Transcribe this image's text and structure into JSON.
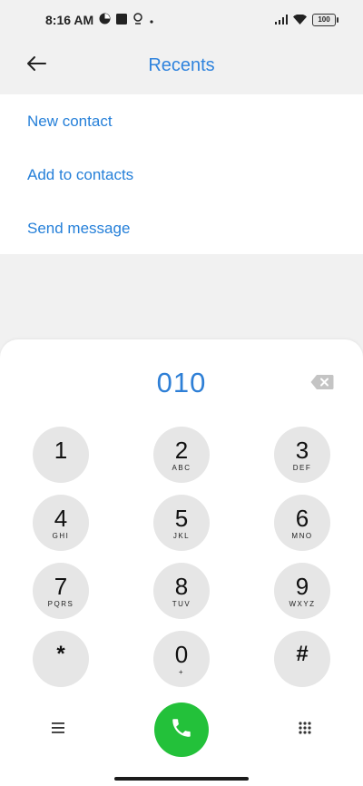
{
  "status_bar": {
    "time": "8:16 AM",
    "battery": "100",
    "icons": [
      "circle-notification-icon",
      "square-app-icon",
      "lock-notification-icon",
      "dot-icon",
      "signal-icon",
      "wifi-icon",
      "battery-icon"
    ]
  },
  "header": {
    "title": "Recents",
    "back_icon": "arrow-left-icon"
  },
  "actions": [
    {
      "label": "New contact"
    },
    {
      "label": "Add to contacts"
    },
    {
      "label": "Send message"
    }
  ],
  "dialer": {
    "number": "010",
    "backspace_icon": "backspace-icon",
    "keys": [
      {
        "digit": "1",
        "letters": ""
      },
      {
        "digit": "2",
        "letters": "ABC"
      },
      {
        "digit": "3",
        "letters": "DEF"
      },
      {
        "digit": "4",
        "letters": "GHI"
      },
      {
        "digit": "5",
        "letters": "JKL"
      },
      {
        "digit": "6",
        "letters": "MNO"
      },
      {
        "digit": "7",
        "letters": "PQRS"
      },
      {
        "digit": "8",
        "letters": "TUV"
      },
      {
        "digit": "9",
        "letters": "WXYZ"
      },
      {
        "digit": "*",
        "letters": ""
      },
      {
        "digit": "0",
        "letters": "+"
      },
      {
        "digit": "#",
        "letters": ""
      }
    ],
    "menu_icon": "menu-icon",
    "call_icon": "phone-icon",
    "keypad_icon": "keypad-grid-icon",
    "call_color": "#23c13a"
  },
  "colors": {
    "accent": "#2f83dd",
    "background": "#f1f1f1"
  }
}
